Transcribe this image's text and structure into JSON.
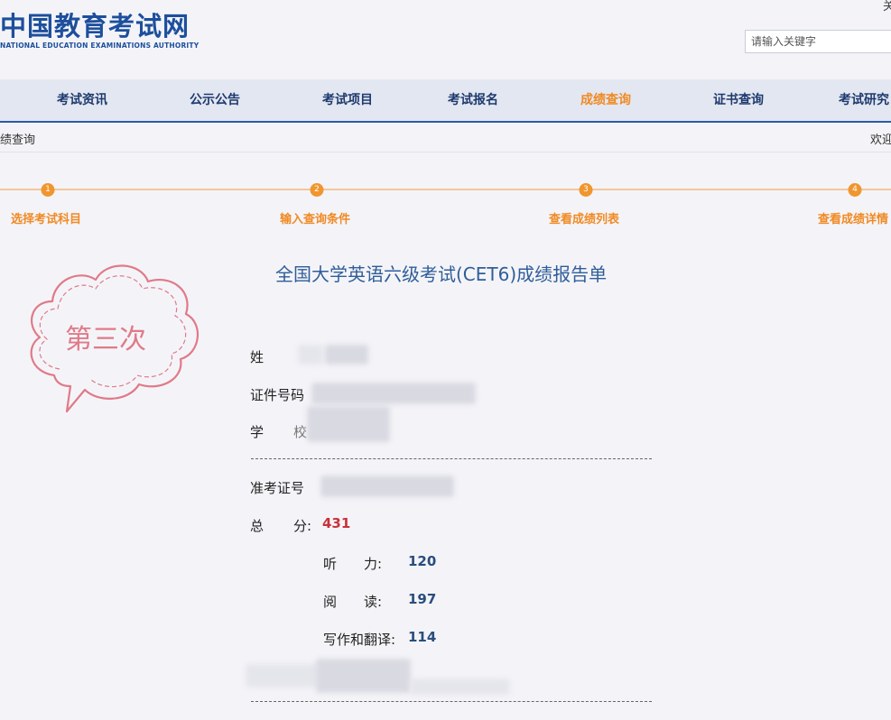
{
  "header": {
    "logo_cn": "中国教育考试网",
    "logo_en": "NATIONAL EDUCATION EXAMINATIONS AUTHORITY",
    "top_right_link": "关",
    "search_placeholder": "请输入关键字"
  },
  "nav": {
    "items": [
      {
        "label": "考试资讯"
      },
      {
        "label": "公示公告"
      },
      {
        "label": "考试项目"
      },
      {
        "label": "考试报名"
      },
      {
        "label": "成绩查询",
        "active": true
      },
      {
        "label": "证书查询"
      },
      {
        "label": "考试研究"
      }
    ]
  },
  "breadcrumb": {
    "current": "绩查询",
    "welcome": "欢迎"
  },
  "steps": [
    {
      "number": "1",
      "label": "选择考试科目"
    },
    {
      "number": "2",
      "label": "输入查询条件"
    },
    {
      "number": "3",
      "label": "查看成绩列表"
    },
    {
      "number": "4",
      "label": "查看成绩详情"
    }
  ],
  "report": {
    "title": "全国大学英语六级考试(CET6)成绩报告单",
    "stamp_text": "第三次",
    "fields": {
      "name_label": "姓",
      "id_label": "证件号码",
      "school_label": "学",
      "school_label_tail": "校",
      "ticket_label": "准考证号"
    },
    "total": {
      "label_a": "总",
      "label_b": "分:",
      "value": "431"
    },
    "subscores": [
      {
        "label": "听　　力:",
        "value": "120"
      },
      {
        "label": "阅　　读:",
        "value": "197"
      },
      {
        "label": "写作和翻译:",
        "value": "114"
      }
    ]
  },
  "colors": {
    "brand_blue": "#1d4f9c",
    "accent_orange": "#f08a24",
    "score_red": "#c8323a",
    "score_blue": "#2a4d7d",
    "stamp_pink": "#e07a88"
  }
}
